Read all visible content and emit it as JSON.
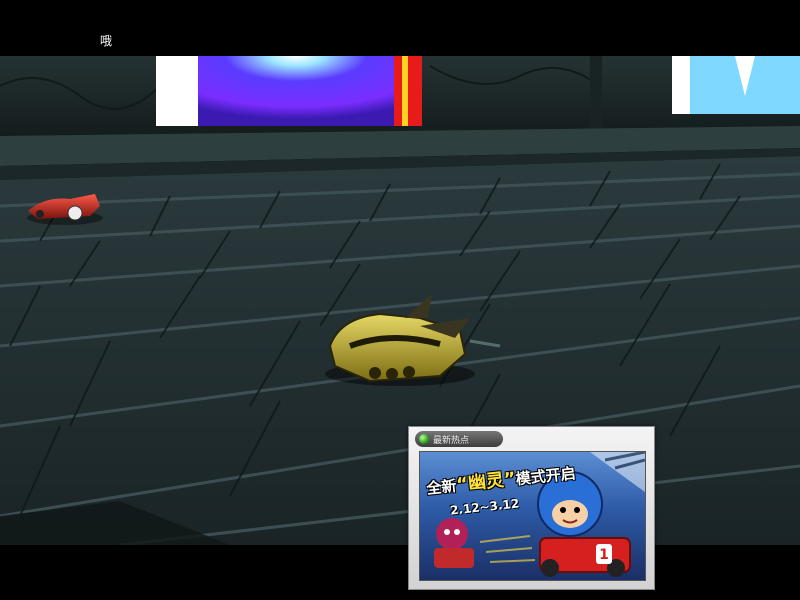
{
  "hud": {
    "top_text": "哦"
  },
  "popup": {
    "title": "最新热点",
    "banner": {
      "title_prefix": "全新",
      "title_accent": "“幽灵”",
      "title_suffix": "模式开启",
      "date_range": "2.12~3.12",
      "kart_number": "1"
    }
  },
  "colors": {
    "floor": "#2b3b3e",
    "wall": "#1e2a2b",
    "player_kart": "#c9b43a",
    "rival_kart": "#c0221c",
    "screen_blue": "#3a2cff",
    "screen_cyan": "#7fd8ff"
  }
}
